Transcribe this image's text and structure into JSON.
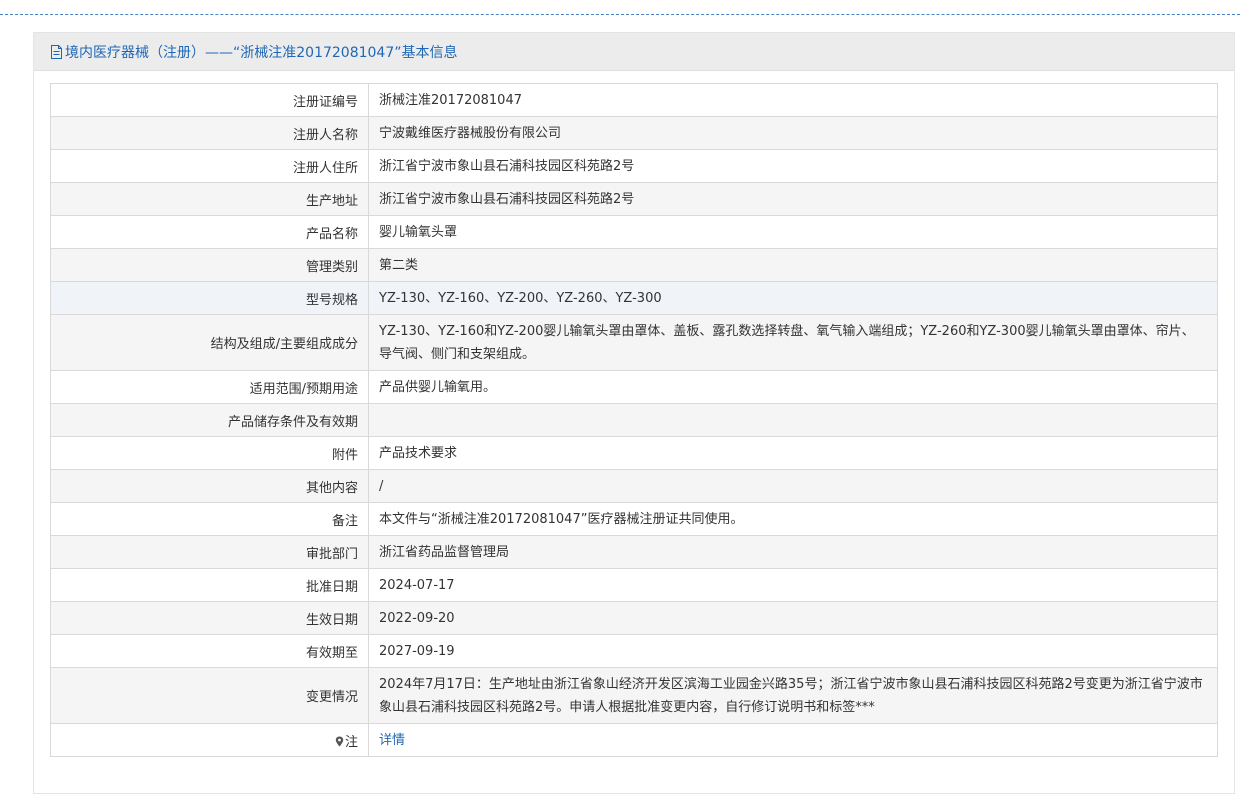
{
  "header": {
    "title": "境内医疗器械（注册）——“浙械注准20172081047”基本信息",
    "icon": "document-icon"
  },
  "rows": [
    {
      "label": "注册证编号",
      "value": "浙械注准20172081047"
    },
    {
      "label": "注册人名称",
      "value": "宁波戴维医疗器械股份有限公司"
    },
    {
      "label": "注册人住所",
      "value": "浙江省宁波市象山县石浦科技园区科苑路2号"
    },
    {
      "label": "生产地址",
      "value": "浙江省宁波市象山县石浦科技园区科苑路2号"
    },
    {
      "label": "产品名称",
      "value": "婴儿输氧头罩"
    },
    {
      "label": "管理类别",
      "value": "第二类"
    },
    {
      "label": "型号规格",
      "value": "YZ-130、YZ-160、YZ-200、YZ-260、YZ-300"
    },
    {
      "label": "结构及组成/主要组成成分",
      "value": "YZ-130、YZ-160和YZ-200婴儿输氧头罩由罩体、盖板、露孔数选择转盘、氧气输入端组成；YZ-260和YZ-300婴儿输氧头罩由罩体、帘片、导气阀、侧门和支架组成。"
    },
    {
      "label": "适用范围/预期用途",
      "value": "产品供婴儿输氧用。"
    },
    {
      "label": "产品储存条件及有效期",
      "value": ""
    },
    {
      "label": "附件",
      "value": "产品技术要求"
    },
    {
      "label": "其他内容",
      "value": "/"
    },
    {
      "label": "备注",
      "value": "本文件与“浙械注准20172081047”医疗器械注册证共同使用。"
    },
    {
      "label": "审批部门",
      "value": "浙江省药品监督管理局"
    },
    {
      "label": "批准日期",
      "value": "2024-07-17"
    },
    {
      "label": "生效日期",
      "value": "2022-09-20"
    },
    {
      "label": "有效期至",
      "value": "2027-09-19"
    },
    {
      "label": "变更情况",
      "value": "2024年7月17日：生产地址由浙江省象山经济开发区滨海工业园金兴路35号；浙江省宁波市象山县石浦科技园区科苑路2号变更为浙江省宁波市象山县石浦科技园区科苑路2号。申请人根据批准变更内容，自行修订说明书和标签***"
    }
  ],
  "note": {
    "label": "注",
    "icon": "pin-icon",
    "link_text": "详情"
  },
  "colors": {
    "accent": "#1f67b6",
    "header_bg": "#ececec",
    "alt_row_bg": "#f5f5f5",
    "highlight_row_bg": "#f0f4f8",
    "border": "#d9d9d9"
  }
}
